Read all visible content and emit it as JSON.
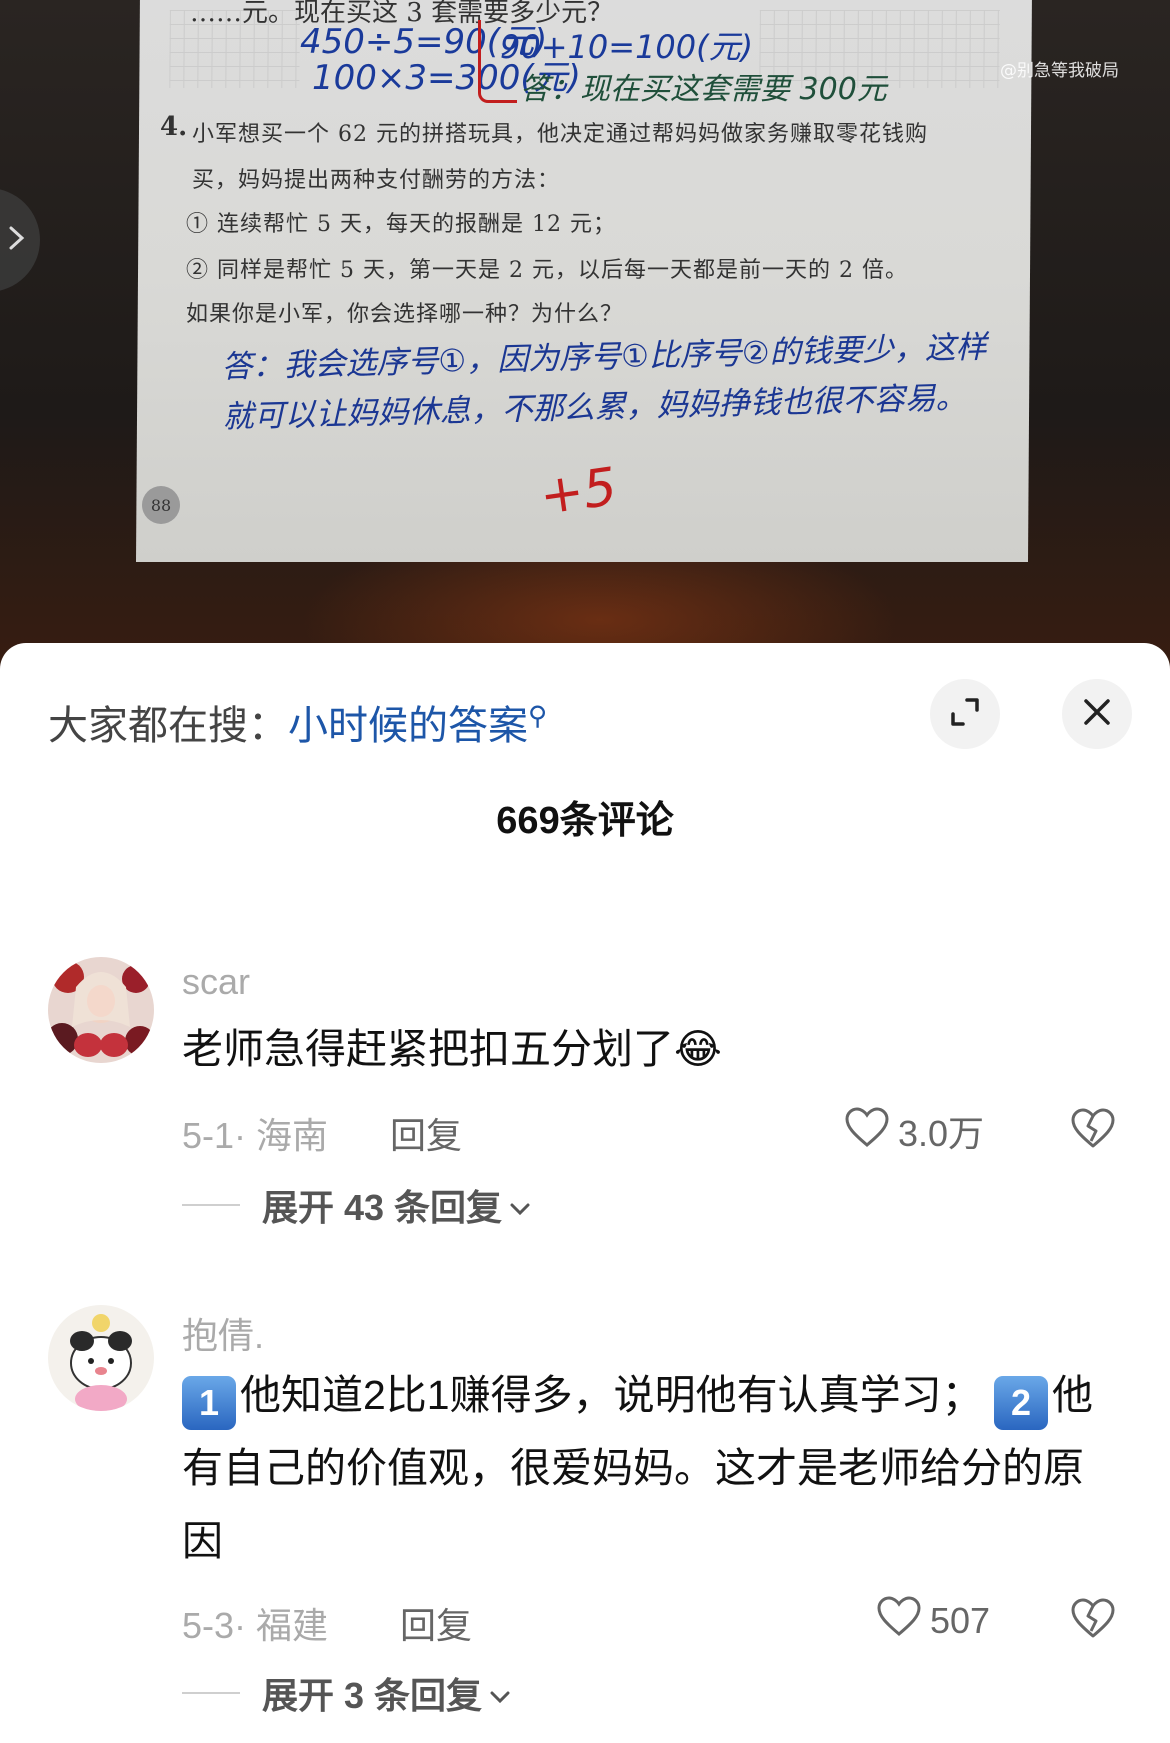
{
  "photo": {
    "prev_question_fragment": "……元。现在买这 3 套需要多少元？",
    "work_line1": "450÷5=90(元)",
    "work_line2": "100×3=300(元)",
    "work_line3": "90+10=100(元)",
    "work_answer": "答：现在买这套需要 300元",
    "q4_number": "4.",
    "q4_line1": "小军想买一个 62 元的拼搭玩具，他决定通过帮妈妈做家务赚取零花钱购",
    "q4_line2": "买，妈妈提出两种支付酬劳的方法：",
    "q4_option1": "① 连续帮忙 5 天，每天的报酬是 12 元；",
    "q4_option2": "② 同样是帮忙 5 天，第一天是 2 元，以后每一天都是前一天的 2 倍。",
    "q4_line5": "如果你是小军，你会选择哪一种？为什么？",
    "handwritten_answer": "答：我会选序号①，因为序号①比序号②的钱要少，这样就可以让妈妈休息，不那么累，妈妈挣钱也很不容易。",
    "score": "+5",
    "page_number": "88",
    "watermark": "@别急等我破局"
  },
  "search": {
    "prefix": "大家都在搜：",
    "term": "小时候的答案"
  },
  "comment_count": "669条评论",
  "comments": [
    {
      "username": "scar",
      "text": "老师急得赶紧把扣五分划了",
      "emoji": "😂",
      "date_location": "5-1· 海南",
      "reply_label": "回复",
      "likes": "3.0万",
      "expand_label": "展开 43 条回复"
    },
    {
      "username": "抱倩.",
      "badge1": "1",
      "text_part1": "他知道2比1赚得多，说明他有认真学习；",
      "badge2": "2",
      "text_part2": "他有自己的价值观，很爱妈妈。这才是老师给分的原因",
      "date_location": "5-3· 福建",
      "reply_label": "回复",
      "likes": "507",
      "expand_label": "展开 3 条回复"
    }
  ],
  "icons": {
    "side_arrow": "chevron-right-icon",
    "expand": "expand-icon",
    "close": "close-icon",
    "like": "heart-icon",
    "dislike": "broken-heart-icon",
    "chevron": "chevron-down-icon"
  },
  "colors": {
    "link_blue": "#1d56a8",
    "muted_gray": "#aaaaaa",
    "red_mark": "#c21e1e"
  }
}
